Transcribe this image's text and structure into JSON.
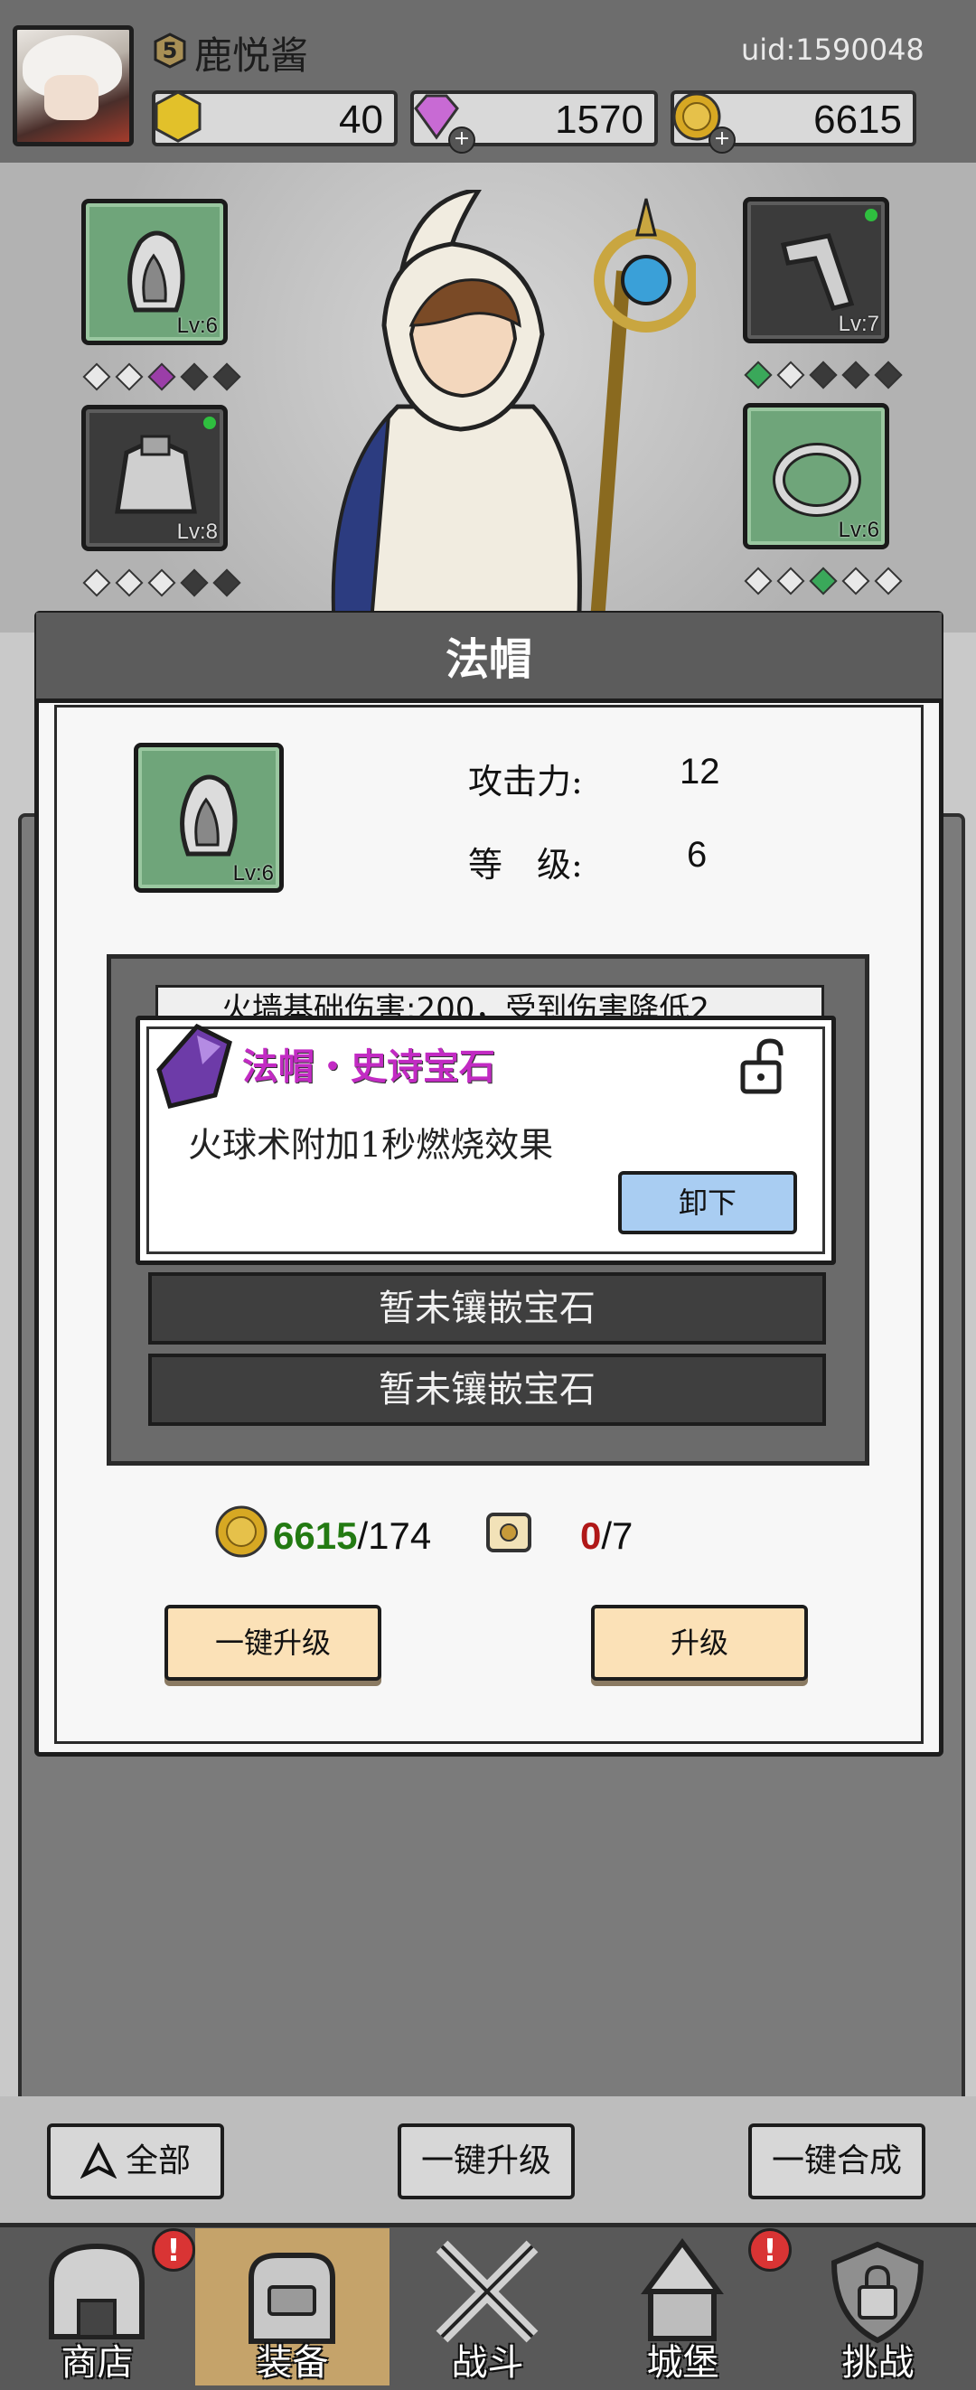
{
  "player": {
    "level": "5",
    "name": "鹿悦酱",
    "uid": "uid:1590048"
  },
  "resources": {
    "stamina": "40",
    "gems": "1570",
    "gold": "6615"
  },
  "slots": [
    {
      "name": "hood",
      "level": "Lv:6",
      "style": "green"
    },
    {
      "name": "armor",
      "level": "Lv:8",
      "style": "dark"
    },
    {
      "name": "bracer",
      "level": "Lv:7",
      "style": "dark"
    },
    {
      "name": "ring",
      "level": "Lv:6",
      "style": "green"
    }
  ],
  "dialog": {
    "title": "法帽",
    "item_level": "Lv:6",
    "attack_label": "攻击力:",
    "attack_value": "12",
    "grade_label": "等　级:",
    "grade_value": "6",
    "scroll_peek": "火墙基础伤害:200，受到伤害降低2",
    "gem": {
      "title": "法帽・史诗宝石",
      "desc": "火球术附加1秒燃烧效果",
      "unload": "卸下"
    },
    "empty_slot_1": "暂未镶嵌宝石",
    "empty_slot_2": "暂未镶嵌宝石",
    "cost": {
      "coin_have": "6615",
      "coin_need": "/174",
      "scroll_have": "0",
      "scroll_need": "/7"
    },
    "btn_auto_upgrade": "一键升级",
    "btn_upgrade": "升级"
  },
  "bottom_bar": {
    "filter_all": "全部",
    "auto_upgrade": "一键升级",
    "auto_merge": "一键合成"
  },
  "nav": [
    {
      "label": "商店",
      "alert": "!"
    },
    {
      "label": "装备",
      "alert": ""
    },
    {
      "label": "战斗",
      "alert": ""
    },
    {
      "label": "城堡",
      "alert": "!"
    },
    {
      "label": "挑战",
      "alert": ""
    }
  ],
  "colors": {
    "accent_gem": "#c22bc3",
    "coin_have": "#237a12",
    "scroll_have": "#b01818",
    "nav_active": "#c5a36a"
  }
}
